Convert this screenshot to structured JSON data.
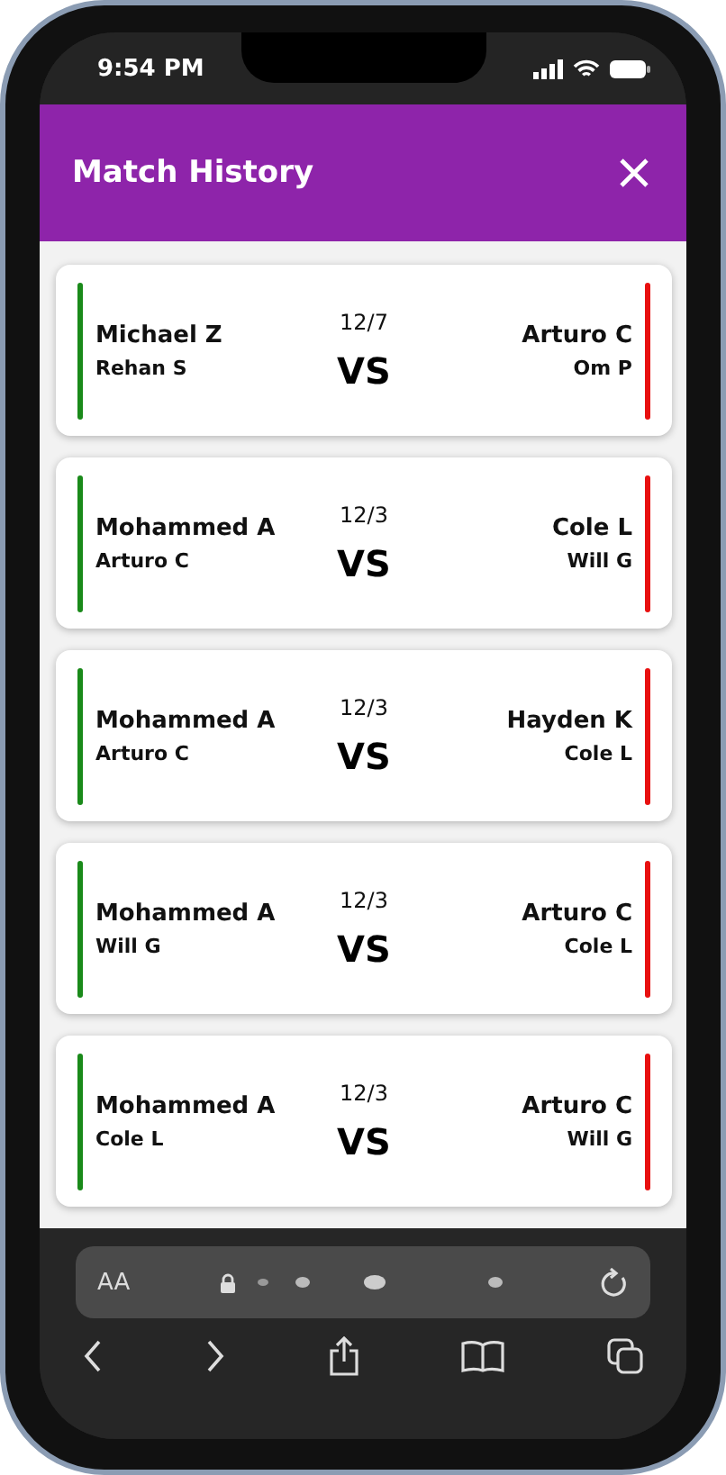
{
  "status_bar": {
    "time": "9:54 PM"
  },
  "header": {
    "title": "Match History"
  },
  "matches": [
    {
      "date": "12/7",
      "versus": "VS",
      "left": {
        "players": [
          "Michael Z",
          "Rehan S"
        ],
        "color": "#1a8a1a"
      },
      "right": {
        "players": [
          "Arturo C",
          "Om P"
        ],
        "color": "#e81010"
      }
    },
    {
      "date": "12/3",
      "versus": "VS",
      "left": {
        "players": [
          "Mohammed A",
          "Arturo C"
        ],
        "color": "#1a8a1a"
      },
      "right": {
        "players": [
          "Cole L",
          "Will G"
        ],
        "color": "#e81010"
      }
    },
    {
      "date": "12/3",
      "versus": "VS",
      "left": {
        "players": [
          "Mohammed A",
          "Arturo C"
        ],
        "color": "#1a8a1a"
      },
      "right": {
        "players": [
          "Hayden K",
          "Cole L"
        ],
        "color": "#e81010"
      }
    },
    {
      "date": "12/3",
      "versus": "VS",
      "left": {
        "players": [
          "Mohammed A",
          "Will G"
        ],
        "color": "#1a8a1a"
      },
      "right": {
        "players": [
          "Arturo C",
          "Cole L"
        ],
        "color": "#e81010"
      }
    },
    {
      "date": "12/3",
      "versus": "VS",
      "left": {
        "players": [
          "Mohammed A",
          "Cole L"
        ],
        "color": "#1a8a1a"
      },
      "right": {
        "players": [
          "Arturo C",
          "Will G"
        ],
        "color": "#e81010"
      }
    }
  ],
  "browser": {
    "text_size_label": "AA"
  }
}
